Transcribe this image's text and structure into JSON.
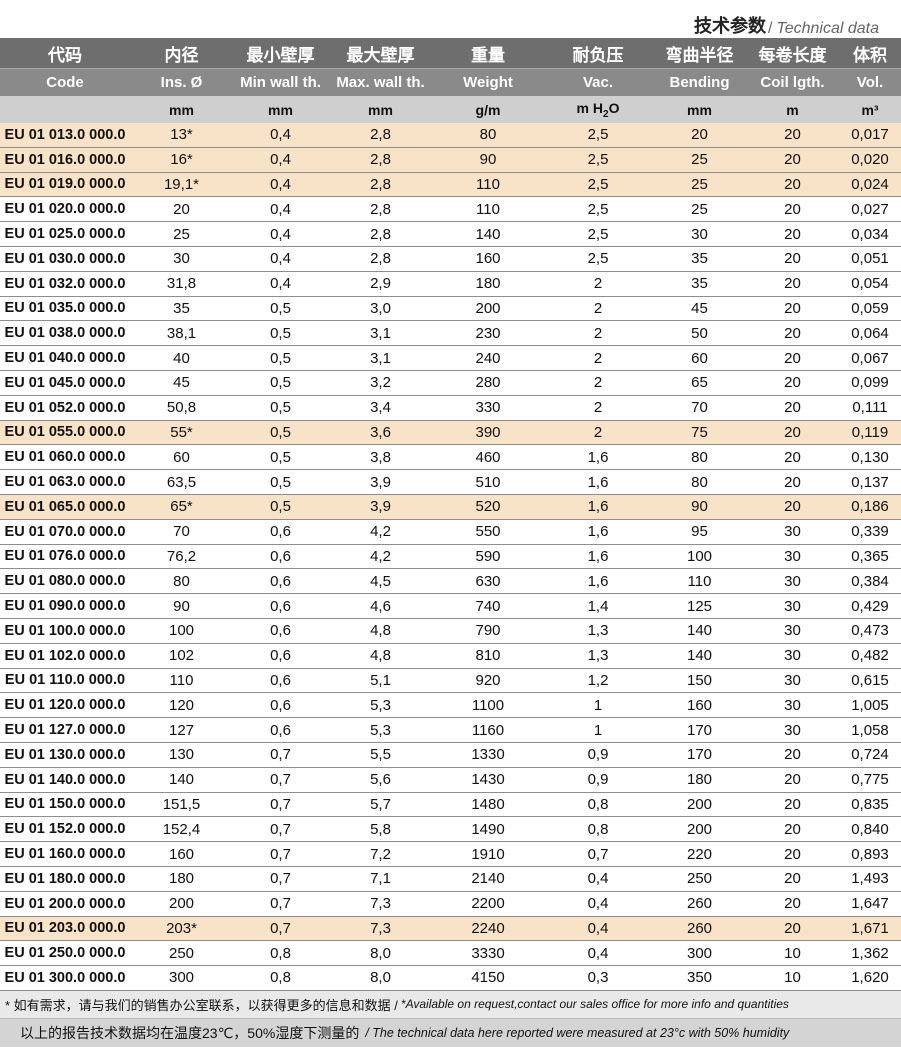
{
  "title": {
    "zh": "技术参数",
    "sep": "/",
    "en": "Technical data"
  },
  "headers_zh": [
    "代码",
    "内径",
    "最小壁厚",
    "最大壁厚",
    "重量",
    "耐负压",
    "弯曲半径",
    "每卷长度",
    "体积"
  ],
  "headers_en": [
    "Code",
    "Ins. Ø",
    "Min wall th.",
    "Max. wall th.",
    "Weight",
    "Vac.",
    "Bending",
    "Coil lgth.",
    "Vol."
  ],
  "units": [
    "",
    "mm",
    "mm",
    "mm",
    "g/m",
    "m H2O",
    "mm",
    "m",
    "m³"
  ],
  "rows": [
    {
      "code": "EU 01 013.0 000.0",
      "ins": "13*",
      "min": "0,4",
      "max": "2,8",
      "weight": "80",
      "vac": "2,5",
      "bend": "20",
      "coil": "20",
      "vol": "0,017",
      "highlight": true
    },
    {
      "code": "EU 01 016.0 000.0",
      "ins": "16*",
      "min": "0,4",
      "max": "2,8",
      "weight": "90",
      "vac": "2,5",
      "bend": "25",
      "coil": "20",
      "vol": "0,020",
      "highlight": true
    },
    {
      "code": "EU 01 019.0 000.0",
      "ins": "19,1*",
      "min": "0,4",
      "max": "2,8",
      "weight": "110",
      "vac": "2,5",
      "bend": "25",
      "coil": "20",
      "vol": "0,024",
      "highlight": true
    },
    {
      "code": "EU 01 020.0 000.0",
      "ins": "20",
      "min": "0,4",
      "max": "2,8",
      "weight": "110",
      "vac": "2,5",
      "bend": "25",
      "coil": "20",
      "vol": "0,027",
      "highlight": false
    },
    {
      "code": "EU 01 025.0 000.0",
      "ins": "25",
      "min": "0,4",
      "max": "2,8",
      "weight": "140",
      "vac": "2,5",
      "bend": "30",
      "coil": "20",
      "vol": "0,034",
      "highlight": false
    },
    {
      "code": "EU 01 030.0 000.0",
      "ins": "30",
      "min": "0,4",
      "max": "2,8",
      "weight": "160",
      "vac": "2,5",
      "bend": "35",
      "coil": "20",
      "vol": "0,051",
      "highlight": false
    },
    {
      "code": "EU 01 032.0 000.0",
      "ins": "31,8",
      "min": "0,4",
      "max": "2,9",
      "weight": "180",
      "vac": "2",
      "bend": "35",
      "coil": "20",
      "vol": "0,054",
      "highlight": false
    },
    {
      "code": "EU 01 035.0 000.0",
      "ins": "35",
      "min": "0,5",
      "max": "3,0",
      "weight": "200",
      "vac": "2",
      "bend": "45",
      "coil": "20",
      "vol": "0,059",
      "highlight": false
    },
    {
      "code": "EU 01 038.0 000.0",
      "ins": "38,1",
      "min": "0,5",
      "max": "3,1",
      "weight": "230",
      "vac": "2",
      "bend": "50",
      "coil": "20",
      "vol": "0,064",
      "highlight": false
    },
    {
      "code": "EU 01 040.0 000.0",
      "ins": "40",
      "min": "0,5",
      "max": "3,1",
      "weight": "240",
      "vac": "2",
      "bend": "60",
      "coil": "20",
      "vol": "0,067",
      "highlight": false
    },
    {
      "code": "EU 01 045.0 000.0",
      "ins": "45",
      "min": "0,5",
      "max": "3,2",
      "weight": "280",
      "vac": "2",
      "bend": "65",
      "coil": "20",
      "vol": "0,099",
      "highlight": false
    },
    {
      "code": "EU 01 052.0 000.0",
      "ins": "50,8",
      "min": "0,5",
      "max": "3,4",
      "weight": "330",
      "vac": "2",
      "bend": "70",
      "coil": "20",
      "vol": "0,111",
      "highlight": false
    },
    {
      "code": "EU 01 055.0 000.0",
      "ins": "55*",
      "min": "0,5",
      "max": "3,6",
      "weight": "390",
      "vac": "2",
      "bend": "75",
      "coil": "20",
      "vol": "0,119",
      "highlight": true
    },
    {
      "code": "EU 01 060.0 000.0",
      "ins": "60",
      "min": "0,5",
      "max": "3,8",
      "weight": "460",
      "vac": "1,6",
      "bend": "80",
      "coil": "20",
      "vol": "0,130",
      "highlight": false
    },
    {
      "code": "EU 01 063.0 000.0",
      "ins": "63,5",
      "min": "0,5",
      "max": "3,9",
      "weight": "510",
      "vac": "1,6",
      "bend": "80",
      "coil": "20",
      "vol": "0,137",
      "highlight": false
    },
    {
      "code": "EU 01 065.0 000.0",
      "ins": "65*",
      "min": "0,5",
      "max": "3,9",
      "weight": "520",
      "vac": "1,6",
      "bend": "90",
      "coil": "20",
      "vol": "0,186",
      "highlight": true
    },
    {
      "code": "EU 01 070.0 000.0",
      "ins": "70",
      "min": "0,6",
      "max": "4,2",
      "weight": "550",
      "vac": "1,6",
      "bend": "95",
      "coil": "30",
      "vol": "0,339",
      "highlight": false
    },
    {
      "code": "EU 01 076.0 000.0",
      "ins": "76,2",
      "min": "0,6",
      "max": "4,2",
      "weight": "590",
      "vac": "1,6",
      "bend": "100",
      "coil": "30",
      "vol": "0,365",
      "highlight": false
    },
    {
      "code": "EU 01 080.0 000.0",
      "ins": "80",
      "min": "0,6",
      "max": "4,5",
      "weight": "630",
      "vac": "1,6",
      "bend": "110",
      "coil": "30",
      "vol": "0,384",
      "highlight": false
    },
    {
      "code": "EU 01 090.0 000.0",
      "ins": "90",
      "min": "0,6",
      "max": "4,6",
      "weight": "740",
      "vac": "1,4",
      "bend": "125",
      "coil": "30",
      "vol": "0,429",
      "highlight": false
    },
    {
      "code": "EU 01 100.0 000.0",
      "ins": "100",
      "min": "0,6",
      "max": "4,8",
      "weight": "790",
      "vac": "1,3",
      "bend": "140",
      "coil": "30",
      "vol": "0,473",
      "highlight": false
    },
    {
      "code": "EU 01 102.0 000.0",
      "ins": "102",
      "min": "0,6",
      "max": "4,8",
      "weight": "810",
      "vac": "1,3",
      "bend": "140",
      "coil": "30",
      "vol": "0,482",
      "highlight": false
    },
    {
      "code": "EU 01 110.0 000.0",
      "ins": "110",
      "min": "0,6",
      "max": "5,1",
      "weight": "920",
      "vac": "1,2",
      "bend": "150",
      "coil": "30",
      "vol": "0,615",
      "highlight": false
    },
    {
      "code": "EU 01 120.0 000.0",
      "ins": "120",
      "min": "0,6",
      "max": "5,3",
      "weight": "1100",
      "vac": "1",
      "bend": "160",
      "coil": "30",
      "vol": "1,005",
      "highlight": false
    },
    {
      "code": "EU 01 127.0 000.0",
      "ins": "127",
      "min": "0,6",
      "max": "5,3",
      "weight": "1160",
      "vac": "1",
      "bend": "170",
      "coil": "30",
      "vol": "1,058",
      "highlight": false
    },
    {
      "code": "EU 01 130.0 000.0",
      "ins": "130",
      "min": "0,7",
      "max": "5,5",
      "weight": "1330",
      "vac": "0,9",
      "bend": "170",
      "coil": "20",
      "vol": "0,724",
      "highlight": false
    },
    {
      "code": "EU 01 140.0 000.0",
      "ins": "140",
      "min": "0,7",
      "max": "5,6",
      "weight": "1430",
      "vac": "0,9",
      "bend": "180",
      "coil": "20",
      "vol": "0,775",
      "highlight": false
    },
    {
      "code": "EU 01 150.0 000.0",
      "ins": "151,5",
      "min": "0,7",
      "max": "5,7",
      "weight": "1480",
      "vac": "0,8",
      "bend": "200",
      "coil": "20",
      "vol": "0,835",
      "highlight": false
    },
    {
      "code": "EU 01 152.0 000.0",
      "ins": "152,4",
      "min": "0,7",
      "max": "5,8",
      "weight": "1490",
      "vac": "0,8",
      "bend": "200",
      "coil": "20",
      "vol": "0,840",
      "highlight": false
    },
    {
      "code": "EU 01 160.0 000.0",
      "ins": "160",
      "min": "0,7",
      "max": "7,2",
      "weight": "1910",
      "vac": "0,7",
      "bend": "220",
      "coil": "20",
      "vol": "0,893",
      "highlight": false
    },
    {
      "code": "EU 01 180.0 000.0",
      "ins": "180",
      "min": "0,7",
      "max": "7,1",
      "weight": "2140",
      "vac": "0,4",
      "bend": "250",
      "coil": "20",
      "vol": "1,493",
      "highlight": false
    },
    {
      "code": "EU 01 200.0 000.0",
      "ins": "200",
      "min": "0,7",
      "max": "7,3",
      "weight": "2200",
      "vac": "0,4",
      "bend": "260",
      "coil": "20",
      "vol": "1,647",
      "highlight": false
    },
    {
      "code": "EU 01 203.0 000.0",
      "ins": "203*",
      "min": "0,7",
      "max": "7,3",
      "weight": "2240",
      "vac": "0,4",
      "bend": "260",
      "coil": "20",
      "vol": "1,671",
      "highlight": true
    },
    {
      "code": "EU 01 250.0 000.0",
      "ins": "250",
      "min": "0,8",
      "max": "8,0",
      "weight": "3330",
      "vac": "0,4",
      "bend": "300",
      "coil": "10",
      "vol": "1,362",
      "highlight": false
    },
    {
      "code": "EU 01 300.0 000.0",
      "ins": "300",
      "min": "0,8",
      "max": "8,0",
      "weight": "4150",
      "vac": "0,3",
      "bend": "350",
      "coil": "10",
      "vol": "1,620",
      "highlight": false
    }
  ],
  "footnote": {
    "zh": "*  如有需求，请与我们的销售办公室联系，以获得更多的信息和数据 /",
    "en": "*Available on request,contact our sales office for more info and quantities"
  },
  "measurement_note": {
    "zh": "以上的报告技术数据均在温度23℃，50%湿度下测量的",
    "en": "/ The technical data here reported were measured at 23°c with 50% humidity"
  },
  "colors": {
    "header_dark": "#6e6e6e",
    "header_mid": "#8a8a8a",
    "header_units": "#cfcfcf",
    "highlight_row": "#f8e3c8"
  }
}
